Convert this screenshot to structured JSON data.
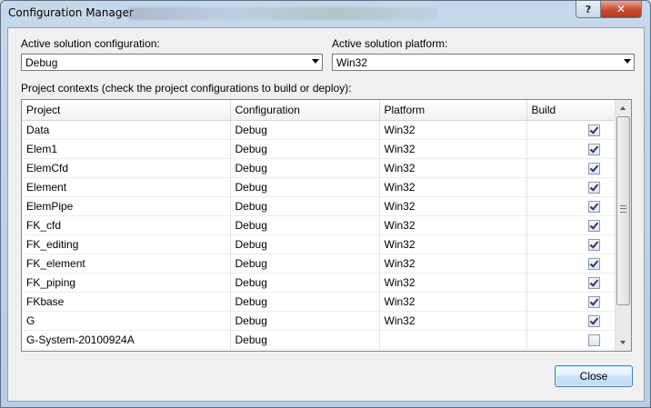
{
  "window": {
    "title": "Configuration Manager"
  },
  "titlebar": {
    "help_glyph": "?",
    "close_glyph": "✕"
  },
  "solution_config": {
    "label": "Active solution configuration:",
    "value": "Debug"
  },
  "solution_platform": {
    "label": "Active solution platform:",
    "value": "Win32"
  },
  "contexts_label": "Project contexts (check the project configurations to build or deploy):",
  "grid": {
    "columns": [
      "Project",
      "Configuration",
      "Platform",
      "Build"
    ],
    "rows": [
      {
        "project": "Data",
        "configuration": "Debug",
        "platform": "Win32",
        "build": true
      },
      {
        "project": "Elem1",
        "configuration": "Debug",
        "platform": "Win32",
        "build": true
      },
      {
        "project": "ElemCfd",
        "configuration": "Debug",
        "platform": "Win32",
        "build": true
      },
      {
        "project": "Element",
        "configuration": "Debug",
        "platform": "Win32",
        "build": true
      },
      {
        "project": "ElemPipe",
        "configuration": "Debug",
        "platform": "Win32",
        "build": true
      },
      {
        "project": "FK_cfd",
        "configuration": "Debug",
        "platform": "Win32",
        "build": true
      },
      {
        "project": "FK_editing",
        "configuration": "Debug",
        "platform": "Win32",
        "build": true
      },
      {
        "project": "FK_element",
        "configuration": "Debug",
        "platform": "Win32",
        "build": true
      },
      {
        "project": "FK_piping",
        "configuration": "Debug",
        "platform": "Win32",
        "build": true
      },
      {
        "project": "FKbase",
        "configuration": "Debug",
        "platform": "Win32",
        "build": true
      },
      {
        "project": "G",
        "configuration": "Debug",
        "platform": "Win32",
        "build": true
      },
      {
        "project": "G-System-20100924A",
        "configuration": "Debug",
        "platform": "",
        "build": false
      }
    ]
  },
  "buttons": {
    "close_label": "Close"
  },
  "colors": {
    "close_button_border": "#3c7fb1",
    "titlebar_close": "#c84a30",
    "window_frame": "#c7d8eb"
  }
}
